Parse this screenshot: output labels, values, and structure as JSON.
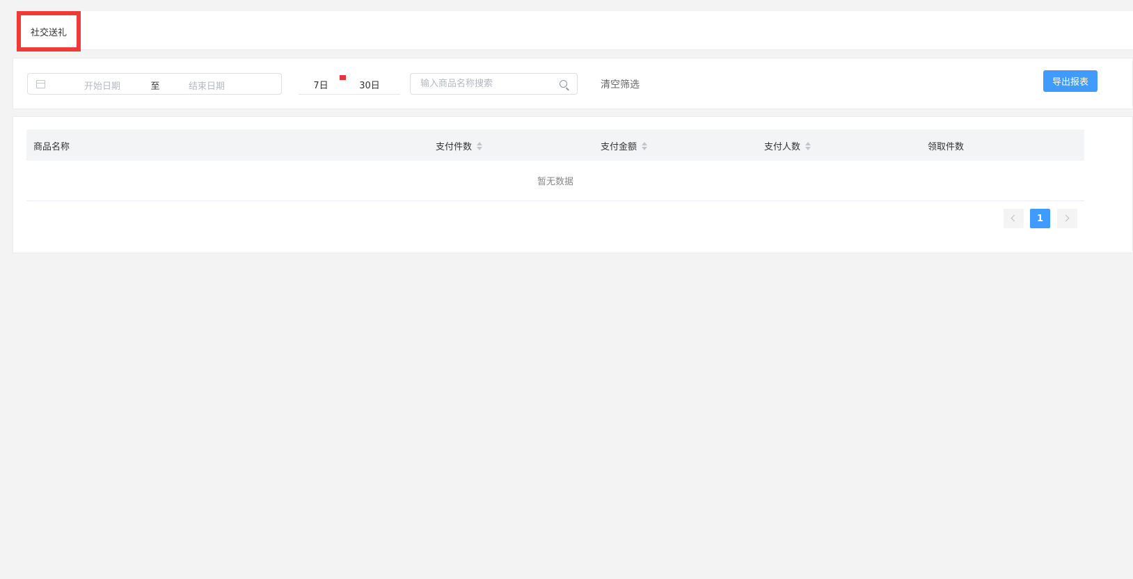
{
  "tabs": [
    {
      "label": "社交送礼",
      "active": true
    }
  ],
  "filters": {
    "start_placeholder": "开始日期",
    "range_separator": "至",
    "end_placeholder": "结束日期",
    "quick_days": [
      "7日",
      "30日"
    ],
    "search_placeholder": "输入商品名称搜索",
    "clear_label": "清空筛选",
    "export_label": "导出报表"
  },
  "table": {
    "columns": [
      {
        "label": "商品名称",
        "sortable": false
      },
      {
        "label": "支付件数",
        "sortable": true
      },
      {
        "label": "支付金额",
        "sortable": true
      },
      {
        "label": "支付人数",
        "sortable": true
      },
      {
        "label": "领取件数",
        "sortable": false
      }
    ],
    "rows": [],
    "empty_text": "暂无数据"
  },
  "pagination": {
    "current_page": "1"
  },
  "colors": {
    "accent": "#3f9cfd",
    "highlight": "#f03a3a"
  },
  "icons": [
    "calendar-icon",
    "search-icon",
    "sort-icon",
    "chevron-left-icon",
    "chevron-right-icon"
  ]
}
